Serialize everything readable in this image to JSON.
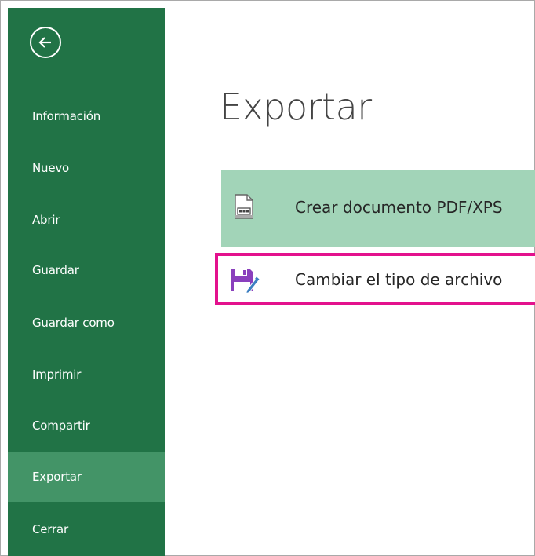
{
  "sidebar": {
    "back_icon": "back-arrow-icon",
    "items": [
      {
        "label": "Información",
        "active": false
      },
      {
        "label": "Nuevo",
        "active": false
      },
      {
        "label": "Abrir",
        "active": false
      },
      {
        "label": "Guardar",
        "active": false
      },
      {
        "label": "Guardar como",
        "active": false
      },
      {
        "label": "Imprimir",
        "active": false
      },
      {
        "label": "Compartir",
        "active": false
      },
      {
        "label": "Exportar",
        "active": true
      },
      {
        "label": "Cerrar",
        "active": false
      }
    ]
  },
  "main": {
    "title": "Exportar",
    "options": [
      {
        "label": "Crear documento PDF/XPS",
        "icon": "pdf-document-icon",
        "highlighted": false
      },
      {
        "label": "Cambiar el tipo de archivo",
        "icon": "save-edit-icon",
        "highlighted": true
      }
    ]
  },
  "colors": {
    "sidebar_bg": "#217346",
    "sidebar_active_bg": "#439467",
    "option_selected_bg": "#a2d4b8",
    "highlight_border": "#e3118d",
    "save_icon": "#8a3fbd"
  }
}
